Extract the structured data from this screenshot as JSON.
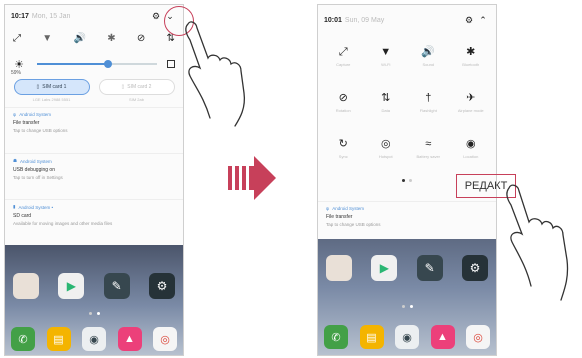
{
  "phone1": {
    "status": {
      "time": "10:17",
      "date": "Mon, 15 Jan"
    },
    "quick_settings": {
      "icons": [
        "rotate-icon",
        "wifi-off-icon",
        "sound-icon",
        "bluetooth-off-icon",
        "dnd-icon",
        "data-icon"
      ]
    },
    "brightness": {
      "percent_label": "59%",
      "level": 0.59
    },
    "sim": {
      "card1": "SIM card 1",
      "card1_sub": "LGE Labs 2988 5551",
      "card2": "SIM card 2",
      "card2_sub": "SIM 2ab"
    },
    "notifications": [
      {
        "app": "Android System",
        "title": "File transfer",
        "text": "Tap to change USB options"
      },
      {
        "app": "Android System",
        "title": "USB debugging on",
        "text": "Tap to turn off in Settings"
      },
      {
        "app": "Android System •",
        "title": "SD card",
        "text": "Available for moving images and other media files"
      }
    ]
  },
  "phone2": {
    "status": {
      "time": "10:01",
      "date": "Sun, 09 May"
    },
    "tiles": [
      {
        "icon": "rotate-icon",
        "glyph": "⤢",
        "label": "Capture"
      },
      {
        "icon": "wifi-icon",
        "glyph": "▼",
        "label": "Wi-Fi"
      },
      {
        "icon": "sound-icon",
        "glyph": "🔊",
        "label": "Sound"
      },
      {
        "icon": "bluetooth-icon",
        "glyph": "✱",
        "label": "Bluetooth"
      },
      {
        "icon": "dnd-icon",
        "glyph": "⊘",
        "label": "Rotation"
      },
      {
        "icon": "data-icon",
        "glyph": "⇅",
        "label": "Data"
      },
      {
        "icon": "flashlight-icon",
        "glyph": "†",
        "label": "Flashlight"
      },
      {
        "icon": "airplane-icon",
        "glyph": "✈",
        "label": "Airplane mode"
      },
      {
        "icon": "sync-icon",
        "glyph": "↻",
        "label": "Sync"
      },
      {
        "icon": "hotspot-icon",
        "glyph": "◎",
        "label": "Hotspot"
      },
      {
        "icon": "vibrate-icon",
        "glyph": "≈",
        "label": "Battery saver"
      },
      {
        "icon": "location-icon",
        "glyph": "◉",
        "label": "Location"
      }
    ],
    "edit_label": "РЕДАКТ",
    "notification": {
      "app": "Android System",
      "title": "File transfer",
      "text": "Tap to change USB options"
    }
  },
  "colors": {
    "highlight": "#c7405a",
    "accent": "#4f8fd6",
    "arrow": "#c7405a"
  }
}
